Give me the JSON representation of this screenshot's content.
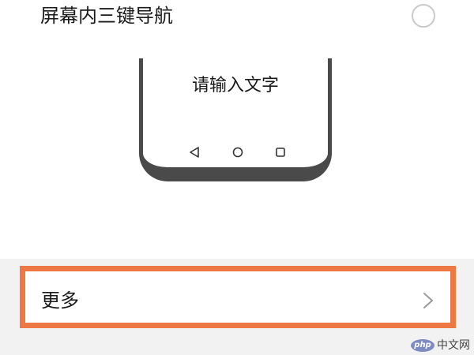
{
  "option": {
    "label": "屏幕内三键导航",
    "selected": false
  },
  "preview": {
    "input_text": "请输入文字",
    "nav_icons": [
      "back-triangle-icon",
      "home-circle-icon",
      "recent-square-icon"
    ]
  },
  "more": {
    "label": "更多",
    "icon": "chevron-right-icon"
  },
  "watermark": {
    "logo": "php",
    "text": "中文网"
  },
  "colors": {
    "highlight_border": "#ee7843",
    "phone_frame": "#4a4a4a",
    "background": "#f2f2f2"
  }
}
